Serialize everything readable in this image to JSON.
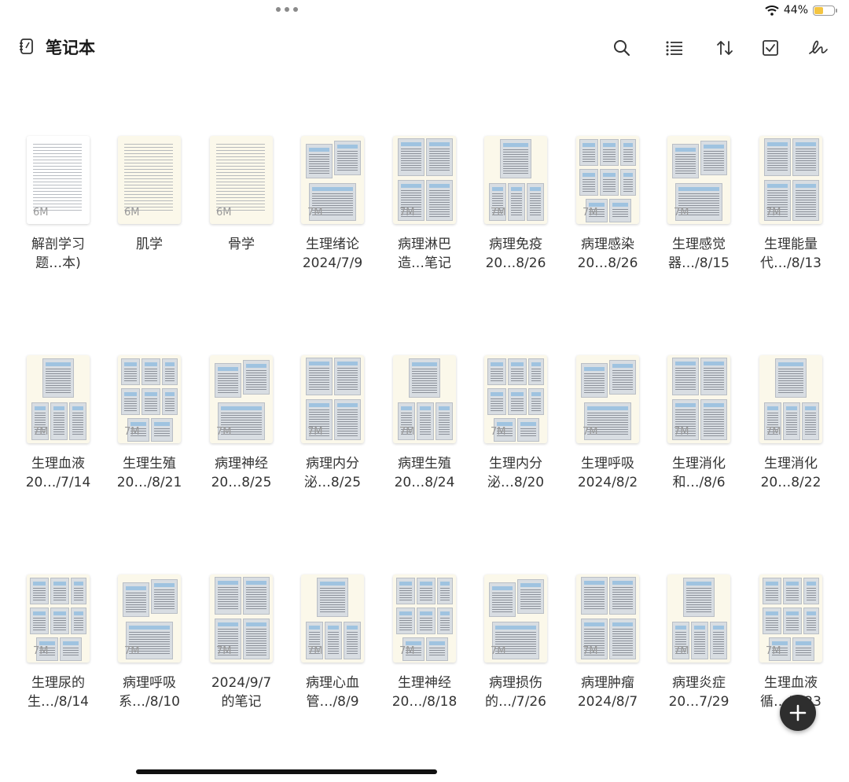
{
  "status": {
    "battery": "44%",
    "battery_level": 0.44
  },
  "header": {
    "title": "笔记本"
  },
  "colors": {
    "thumb_bg": "#fbf8ea",
    "fab": "#2e2e2e",
    "battery": "#f4c542"
  },
  "notebooks": [
    {
      "line1": "解剖学习",
      "line2": "题…本)",
      "size": "6M",
      "style": "text"
    },
    {
      "line1": "肌学",
      "line2": "",
      "size": "6M",
      "style": "text"
    },
    {
      "line1": "骨学",
      "line2": "",
      "size": "6M",
      "style": "text"
    },
    {
      "line1": "生理绪论",
      "line2": "2024/7/9",
      "size": "7M",
      "style": "photos"
    },
    {
      "line1": "病理淋巴",
      "line2": "造…笔记",
      "size": "7M",
      "style": "photos"
    },
    {
      "line1": "病理免疫",
      "line2": "20…8/26",
      "size": "7M",
      "style": "photos"
    },
    {
      "line1": "病理感染",
      "line2": "20…8/26",
      "size": "7M",
      "style": "photos"
    },
    {
      "line1": "生理感觉",
      "line2": "器…/8/15",
      "size": "7M",
      "style": "photos"
    },
    {
      "line1": "生理能量",
      "line2": "代…/8/13",
      "size": "7M",
      "style": "photos"
    },
    {
      "line1": "生理血液",
      "line2": "20…/7/14",
      "size": "7M",
      "style": "photos"
    },
    {
      "line1": "生理生殖",
      "line2": "20…/8/21",
      "size": "7M",
      "style": "photos"
    },
    {
      "line1": "病理神经",
      "line2": "20…8/25",
      "size": "7M",
      "style": "photos"
    },
    {
      "line1": "病理内分",
      "line2": "泌…8/25",
      "size": "7M",
      "style": "photos"
    },
    {
      "line1": "病理生殖",
      "line2": "20…8/24",
      "size": "7M",
      "style": "photos"
    },
    {
      "line1": "生理内分",
      "line2": "泌…8/20",
      "size": "7M",
      "style": "photos"
    },
    {
      "line1": "生理呼吸",
      "line2": "2024/8/2",
      "size": "7M",
      "style": "photos"
    },
    {
      "line1": "生理消化",
      "line2": "和…/8/6",
      "size": "7M",
      "style": "photos"
    },
    {
      "line1": "生理消化",
      "line2": "20…8/22",
      "size": "7M",
      "style": "photos"
    },
    {
      "line1": "生理尿的",
      "line2": "生…/8/14",
      "size": "7M",
      "style": "photos"
    },
    {
      "line1": "病理呼吸",
      "line2": "系…/8/10",
      "size": "7M",
      "style": "photos"
    },
    {
      "line1": "2024/9/7",
      "line2": "的笔记",
      "size": "7M",
      "style": "photos"
    },
    {
      "line1": "病理心血",
      "line2": "管…/8/9",
      "size": "7M",
      "style": "photos"
    },
    {
      "line1": "生理神经",
      "line2": "20…/8/18",
      "size": "7M",
      "style": "photos"
    },
    {
      "line1": "病理损伤",
      "line2": "的…/7/26",
      "size": "7M",
      "style": "photos"
    },
    {
      "line1": "病理肿瘤",
      "line2": "2024/8/7",
      "size": "7M",
      "style": "photos"
    },
    {
      "line1": "病理炎症",
      "line2": "20…7/29",
      "size": "7M",
      "style": "photos"
    },
    {
      "line1": "生理血液",
      "line2": "循…/8/23",
      "size": "7M",
      "style": "photos"
    }
  ]
}
